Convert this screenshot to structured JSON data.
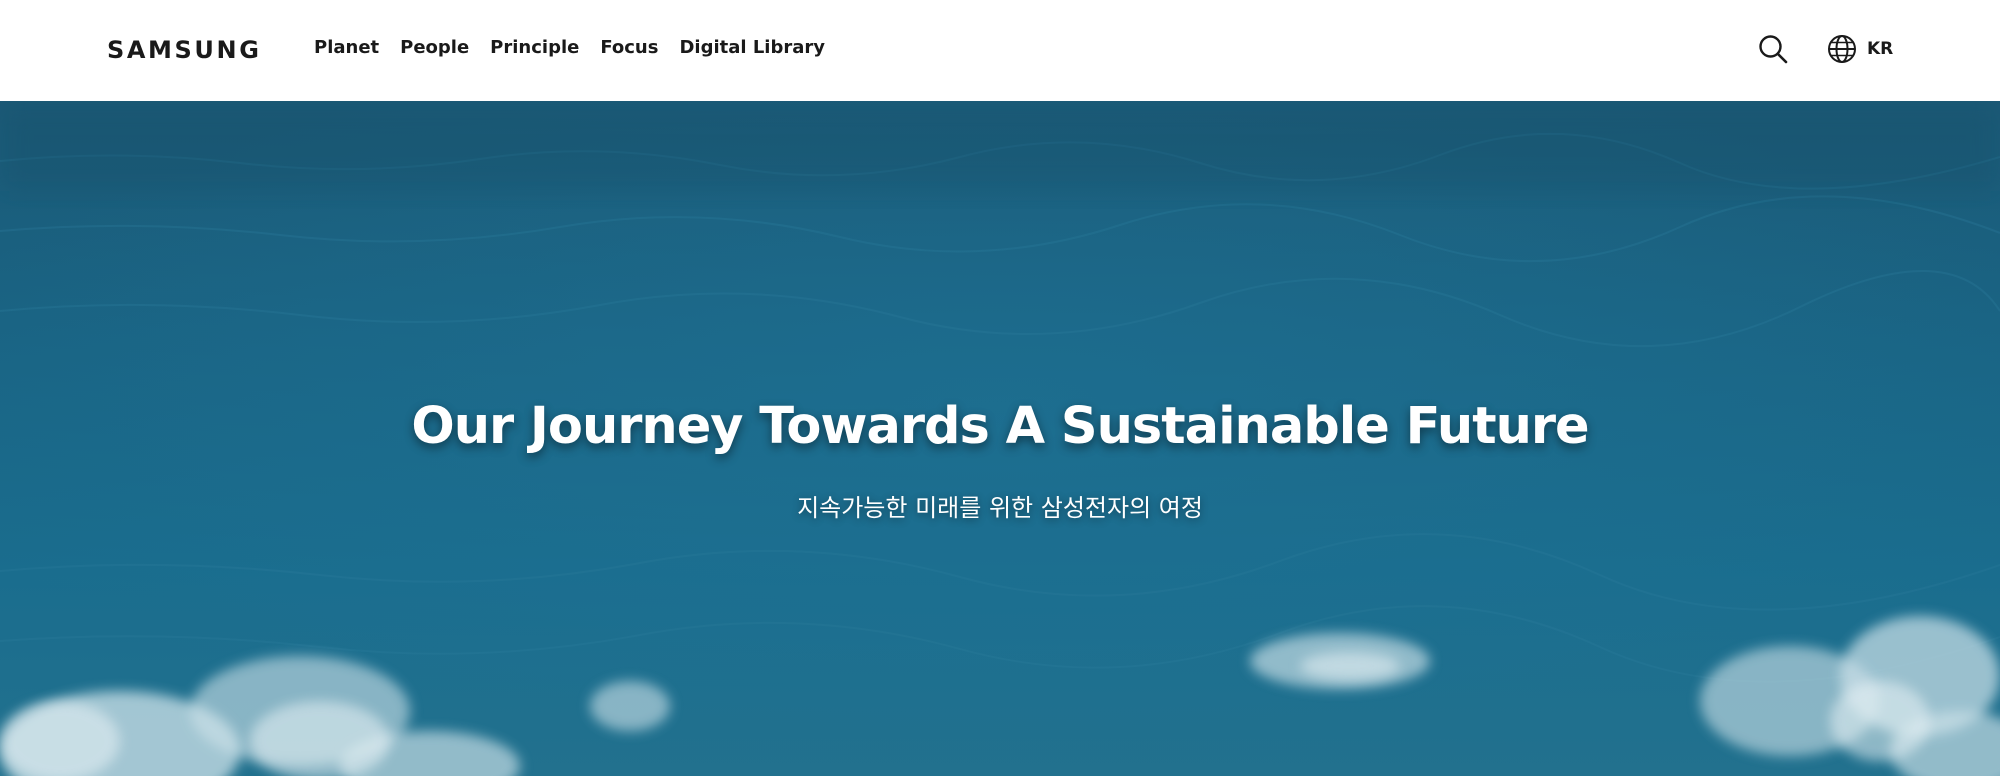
{
  "header": {
    "logo_text": "SAMSUNG",
    "nav": [
      {
        "label": "Planet"
      },
      {
        "label": "People"
      },
      {
        "label": "Principle"
      },
      {
        "label": "Focus"
      },
      {
        "label": "Digital Library"
      }
    ],
    "search_icon": "search-icon",
    "language": {
      "icon": "globe-icon",
      "label": "KR"
    }
  },
  "hero": {
    "title": "Our Journey Towards A Sustainable Future",
    "subtitle": "지속가능한 미래를 위한 삼성전자의 여정",
    "background": "ocean-waves-aerial"
  },
  "colors": {
    "text_dark": "#1a1a1a",
    "header_bg": "#ffffff",
    "ocean_deep": "#1c5c78",
    "ocean_mid": "#1a6a8a",
    "foam": "#cfe3ea"
  }
}
